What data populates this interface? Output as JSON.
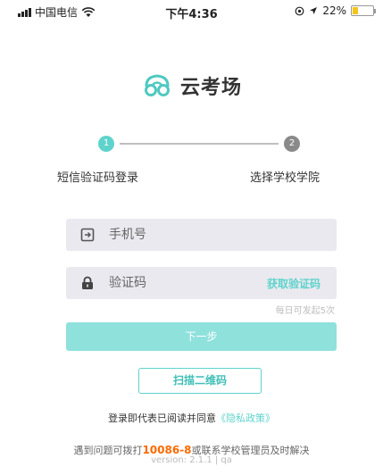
{
  "status_bar": {
    "carrier": "中国电信",
    "time": "下午4:36",
    "battery": "22%",
    "battery_level": 0.22
  },
  "brand": {
    "name": "云考场",
    "accent": "#5ed3cc"
  },
  "steps": [
    {
      "number": "1",
      "label": "短信验证码登录",
      "active": true
    },
    {
      "number": "2",
      "label": "选择学校学院",
      "active": false
    }
  ],
  "form": {
    "phone_placeholder": "手机号",
    "code_placeholder": "验证码",
    "get_code_label": "获取验证码",
    "daily_limit_hint": "每日可发起5次",
    "next_label": "下一步",
    "scan_label": "扫描二维码"
  },
  "agreement": {
    "text": "登录即代表已阅读并同意",
    "policy_link": "《隐私政策》"
  },
  "help": {
    "prefix": "遇到问题可拨打",
    "phone": "10086-8",
    "suffix": "或联系学校管理员及时解决",
    "version": "version: 2.1.1 | qa"
  }
}
